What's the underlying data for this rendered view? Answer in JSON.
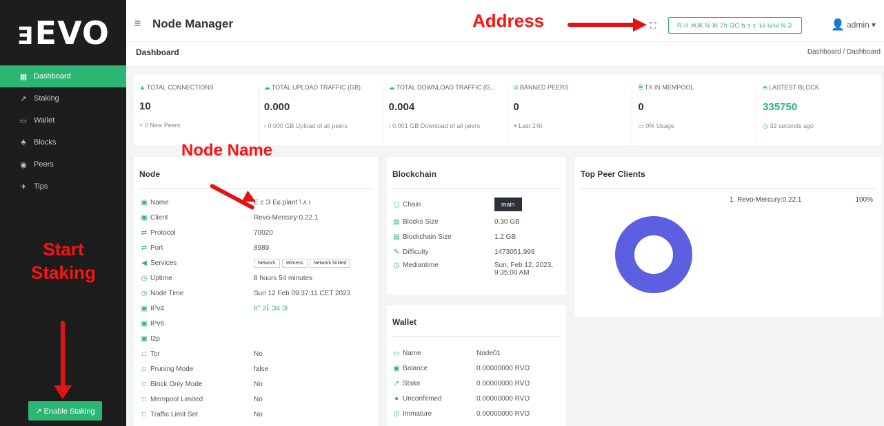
{
  "sidebar": {
    "logo": "ⱻEVO",
    "items": [
      {
        "label": "Dashboard",
        "icon": "grid-icon",
        "glyph": "▦"
      },
      {
        "label": "Staking",
        "icon": "staking-icon",
        "glyph": "↗"
      },
      {
        "label": "Wallet",
        "icon": "wallet-icon",
        "glyph": "▭"
      },
      {
        "label": "Blocks",
        "icon": "blocks-icon",
        "glyph": "♣"
      },
      {
        "label": "Peers",
        "icon": "peers-icon",
        "glyph": "◉"
      },
      {
        "label": "Tips",
        "icon": "rocket-icon",
        "glyph": "✈"
      }
    ],
    "enable_button": "↗ Enable Staking"
  },
  "annotations": {
    "address": "Address",
    "node_name": "Node Name",
    "start_staking": "Start Staking"
  },
  "header": {
    "title": "Node Manager",
    "address_value": "R H ЖЖ N Ж 7h ЭС h з з 'Ы ЫЫ N З",
    "user": "admin ▾",
    "page_title": "Dashboard",
    "breadcrumb": "Dashboard / Dashboard"
  },
  "stats": [
    {
      "label": "TOTAL CONNECTIONS",
      "value": "10",
      "sub_icon": "+",
      "sub": "0 New Peers"
    },
    {
      "label": "TOTAL UPLOAD TRAFFIC (GB)",
      "value": "0.000",
      "sub_icon": "›",
      "sub": "0.000 GB Upload of all peers"
    },
    {
      "label": "TOTAL DOWNLOAD TRAFFIC (G...",
      "value": "0.004",
      "sub_icon": "›",
      "sub": "0.001 GB Download of all peers"
    },
    {
      "label": "BANNED PEERS",
      "value": "0",
      "sub_icon": "+",
      "sub": "Last 24h"
    },
    {
      "label": "TX IN MEMPOOL",
      "value": "0",
      "sub_icon": "▭",
      "sub": "0% Usage"
    },
    {
      "label": "LASTEST BLOCK",
      "value": "335750",
      "sub_icon": "◷",
      "sub": "32 seconds ago"
    }
  ],
  "node": {
    "title": "Node",
    "rows": [
      {
        "k": "Name",
        "v": "E c Э Eɕ plant \\ ʌ ı"
      },
      {
        "k": "Client",
        "v": "Revo-Mercury:0.22.1"
      },
      {
        "k": "Protocol",
        "v": "70020"
      },
      {
        "k": "Port",
        "v": "8989"
      },
      {
        "k": "Services",
        "v": ""
      },
      {
        "k": "Uptime",
        "v": "8 hours 54 minutes"
      },
      {
        "k": "Node Time",
        "v": "Sun 12 Feb 09:37:11 CET 2023"
      },
      {
        "k": "IPv4",
        "v": "К° 2Ĺ З4 Зl"
      },
      {
        "k": "IPv6",
        "v": ""
      },
      {
        "k": "I2p",
        "v": ""
      },
      {
        "k": "Tor",
        "v": "No"
      },
      {
        "k": "Pruning Mode",
        "v": "false"
      },
      {
        "k": "Block Only Mode",
        "v": "No"
      },
      {
        "k": "Mempool Limited",
        "v": "No"
      },
      {
        "k": "Traffic Limit Set",
        "v": "No"
      }
    ],
    "services": [
      "Network",
      "Witness",
      "Network limited"
    ]
  },
  "blockchain": {
    "title": "Blockchain",
    "chain": "main",
    "rows": [
      {
        "k": "Chain",
        "v": ""
      },
      {
        "k": "Blocks Size",
        "v": "0.30 GB"
      },
      {
        "k": "Blockchain Size",
        "v": "1.2 GB"
      },
      {
        "k": "Difficulty",
        "v": "1473051.999"
      },
      {
        "k": "Mediantime",
        "v": "Sun, Feb 12, 2023, 9:35:00 AM"
      }
    ]
  },
  "wallet": {
    "title": "Wallet",
    "rows": [
      {
        "k": "Name",
        "v": "Node01"
      },
      {
        "k": "Balance",
        "v": "0.00000000 RVO"
      },
      {
        "k": "Stake",
        "v": "0.00000000 RVO"
      },
      {
        "k": "Unconfirmed",
        "v": "0.00000000 RVO"
      },
      {
        "k": "Immature",
        "v": "0.00000000 RVO"
      }
    ]
  },
  "peers": {
    "title": "Top Peer Clients",
    "client": "1. Revo-Mercury:0.22.1",
    "pct": "100%"
  },
  "colors": {
    "accent": "#2bb673",
    "donut": "#5b5fe0",
    "annotation": "#ff1111"
  }
}
